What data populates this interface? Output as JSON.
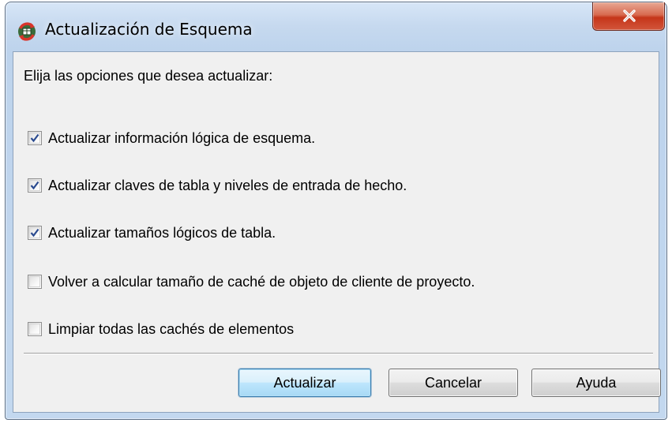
{
  "window": {
    "title": "Actualización de Esquema",
    "close_icon": "close-x-icon",
    "app_icon": "schema-update-icon"
  },
  "prompt": "Elija las opciones que desea actualizar:",
  "options": [
    {
      "label": "Actualizar información lógica de esquema.",
      "checked": true
    },
    {
      "label": "Actualizar claves de tabla y niveles de entrada de hecho.",
      "checked": true
    },
    {
      "label": "Actualizar tamaños lógicos de tabla.",
      "checked": true
    },
    {
      "label": "Volver a calcular tamaño de caché de objeto de cliente de proyecto.",
      "checked": false
    },
    {
      "label": "Limpiar todas las cachés de elementos",
      "checked": false
    }
  ],
  "buttons": {
    "update": "Actualizar",
    "cancel": "Cancelar",
    "help": "Ayuda"
  },
  "colors": {
    "checkmark": "#2a4a8f",
    "close_button": "#c5361a"
  }
}
